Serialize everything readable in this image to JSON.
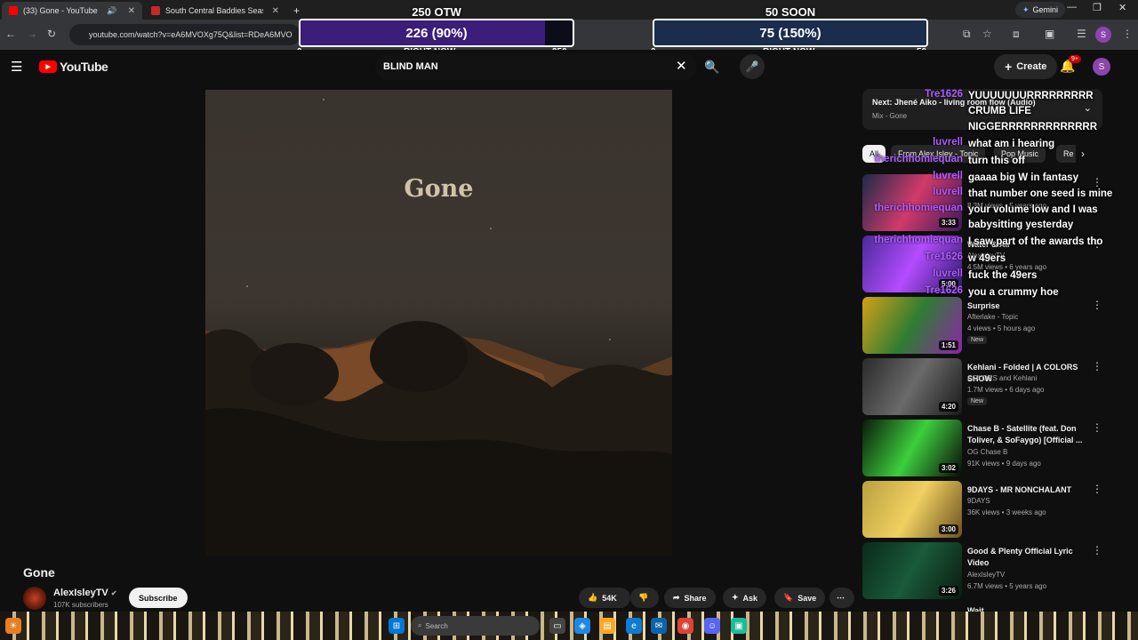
{
  "browser": {
    "tabs": [
      {
        "label": "(33) Gone - YouTube",
        "active": true,
        "favicon_color": "#ff0000"
      },
      {
        "label": "South Central Baddies Season",
        "active": false,
        "favicon_color": "#c62828"
      }
    ],
    "new_tab": "+",
    "gemini_label": "Gemini",
    "url": "youtube.com/watch?v=eA6MVOXg75Q&list=RDeA6MVO",
    "profile_initial": "S"
  },
  "goals": [
    {
      "title": "250 OTW",
      "value_label": "226 (90%)",
      "progress": 0.9,
      "min": "0",
      "max": "250",
      "caption": "RIGHT NOW",
      "fill_color": "#3b1d7a"
    },
    {
      "title": "50 SOON",
      "value_label": "75 (150%)",
      "progress": 1.0,
      "min": "0",
      "max": "50",
      "caption": "RIGHT NOW",
      "fill_color": "#1a2d4d"
    }
  ],
  "header": {
    "logo_text": "YouTube",
    "search_value": "BLIND MAN",
    "create_label": "Create",
    "notif_badge": "9+",
    "avatar_initial": "S"
  },
  "video": {
    "cover_text": "Gone",
    "title": "Gone",
    "channel": "AlexIsleyTV",
    "subscribers": "107K subscribers",
    "subscribe_label": "Subscribe",
    "likes": "54K",
    "share_label": "Share",
    "ask_label": "Ask",
    "save_label": "Save"
  },
  "sidebar": {
    "mix_next": "Next: Jhené Aiko - living room flow (Audio)",
    "mix_sub": "Mix - Gone",
    "chips": [
      "All",
      "From Alex Isley - Topic",
      "Pop Music",
      "Re"
    ],
    "recommendations": [
      {
        "title": "",
        "channel": "",
        "meta": "8.3M views • 5 years ago",
        "duration": "3:33",
        "new": "",
        "thumb": [
          "#1b2a4a",
          "#d13a6a",
          "#3a1a5a"
        ]
      },
      {
        "title": "Water & Air",
        "channel": "AlexIsleyTV",
        "meta": "4.5M views • 6 years ago",
        "duration": "5:00",
        "new": "",
        "thumb": [
          "#4a2a9a",
          "#b44cff",
          "#2a1a6a"
        ]
      },
      {
        "title": "Surprise",
        "channel": "Afterlake - Topic",
        "meta": "4 views • 5 hours ago",
        "duration": "1:51",
        "new": "New",
        "thumb": [
          "#d4a017",
          "#2e7d32",
          "#8e24aa"
        ]
      },
      {
        "title": "Kehlani - Folded | A COLORS SHOW",
        "channel": "COLORS and Kehlani",
        "meta": "1.7M views • 6 days ago",
        "duration": "4:20",
        "new": "New",
        "thumb": [
          "#2a2a2a",
          "#6a6a6a",
          "#1a1a1a"
        ]
      },
      {
        "title": "Chase B - Satellite (feat. Don Toliver, & SoFaygo) [Official ...",
        "channel": "OG Chase B",
        "meta": "91K views • 9 days ago",
        "duration": "3:02",
        "new": "",
        "thumb": [
          "#0a1a0a",
          "#3ccf3c",
          "#0a0a0a"
        ]
      },
      {
        "title": "9DAYS - MR NONCHALANT",
        "channel": "9DAYS",
        "meta": "36K views • 3 weeks ago",
        "duration": "3:00",
        "new": "",
        "thumb": [
          "#b8a040",
          "#f0d060",
          "#6a5020"
        ]
      },
      {
        "title": "Good & Plenty Official Lyric Video",
        "channel": "AlexIsleyTV",
        "meta": "6.7M views • 5 years ago",
        "duration": "3:26",
        "new": "",
        "thumb": [
          "#0a2a1a",
          "#1a5a3a",
          "#0a1a10"
        ]
      }
    ],
    "next_partial": "Wait"
  },
  "chat": [
    {
      "user": "Tre1626",
      "msg": "YUUUUUUURRRRRRRRR CRUMB LIFE"
    },
    {
      "user": "",
      "msg": "NIGGERRRRRRRRRRRRR"
    },
    {
      "user": "luvrell",
      "msg": "what am i hearing"
    },
    {
      "user": "therichhomiequan",
      "msg": "turn this off"
    },
    {
      "user": "luvrell",
      "msg": "gaaaa big W in fantasy"
    },
    {
      "user": "luvrell",
      "msg": "that number one seed is mine"
    },
    {
      "user": "therichhomiequan",
      "msg": "your volume low and I was babysitting yesterday"
    },
    {
      "user": "therichhomiequan",
      "msg": "I saw part of the awards tho"
    },
    {
      "user": "Tre1626",
      "msg": "w 49ers"
    },
    {
      "user": "luvrell",
      "msg": "fuck the 49ers"
    },
    {
      "user": "Tre1626",
      "msg": "you a crummy hoe"
    }
  ],
  "taskbar": {
    "search_placeholder": "Search"
  }
}
